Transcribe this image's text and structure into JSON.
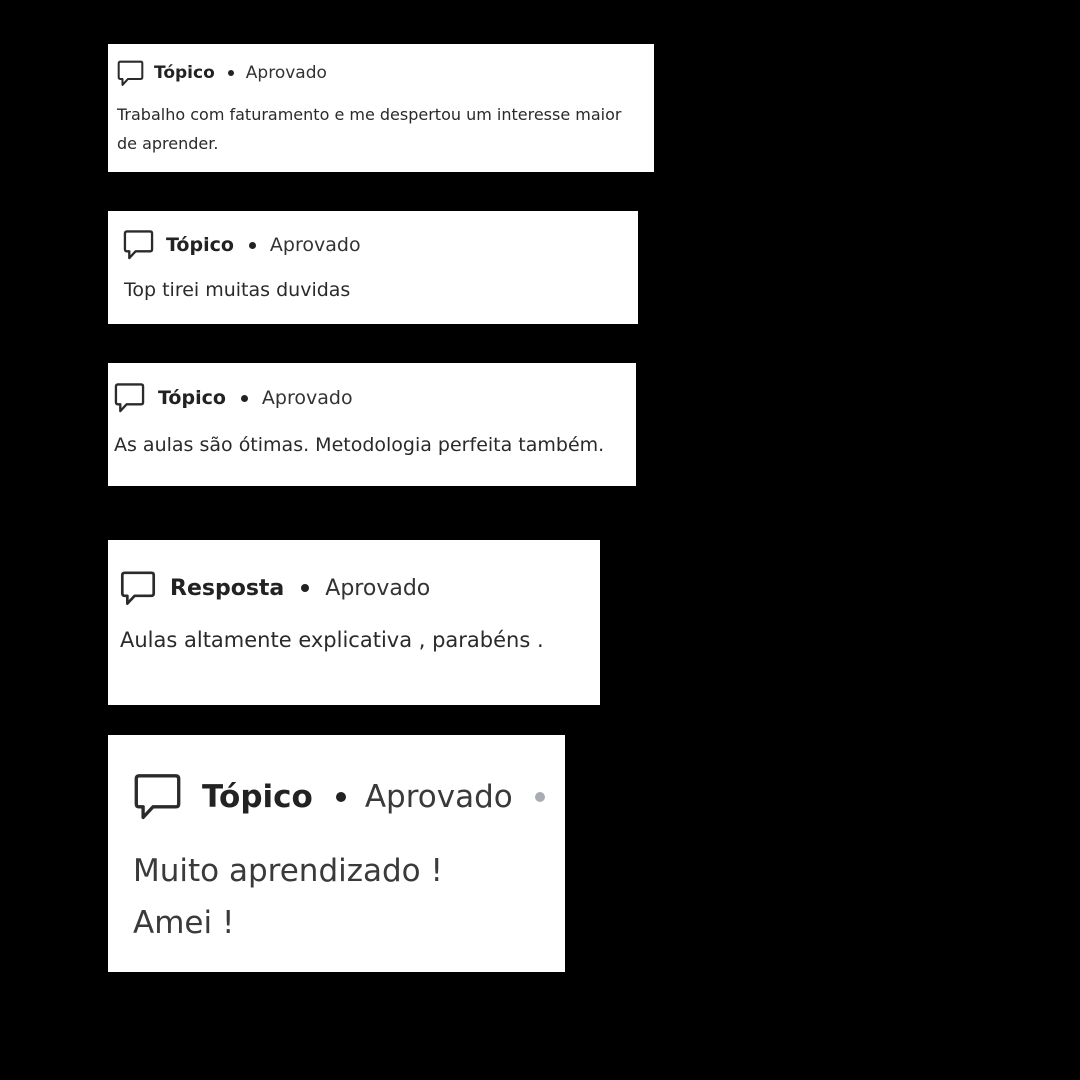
{
  "cards": [
    {
      "icon": "speech-bubble-icon",
      "type_label": "Tópico",
      "status_label": "Aprovado",
      "text_lines": [
        "Trabalho com faturamento e me despertou um interesse maior",
        "de aprender."
      ]
    },
    {
      "icon": "speech-bubble-icon",
      "type_label": "Tópico",
      "status_label": "Aprovado",
      "text_lines": [
        "Top tirei muitas duvidas"
      ]
    },
    {
      "icon": "speech-bubble-icon",
      "type_label": "Tópico",
      "status_label": "Aprovado",
      "text_lines": [
        "As aulas são ótimas. Metodologia perfeita também."
      ]
    },
    {
      "icon": "speech-bubble-icon",
      "type_label": "Resposta",
      "status_label": "Aprovado",
      "text_lines": [
        "Aulas altamente explicativa , parabéns ."
      ]
    },
    {
      "icon": "speech-bubble-icon",
      "type_label": "Tópico",
      "status_label": "Aprovado",
      "text_lines": [
        "Muito aprendizado !",
        "Amei !"
      ]
    }
  ],
  "colors": {
    "background": "#000000",
    "card": "#ffffff",
    "text": "#222222",
    "faint_dot": "#a9adb3"
  }
}
